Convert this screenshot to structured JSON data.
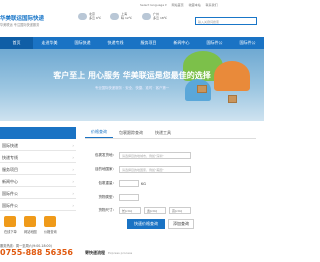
{
  "header": {
    "logo_title": "华美联运国际快递",
    "logo_sub": "华美联运 专注国际快递服务",
    "weather": [
      {
        "city": "北京",
        "temp": "多云 6℃"
      },
      {
        "city": "上海",
        "temp": "晴 12℃"
      },
      {
        "city": "广州",
        "temp": "多云 18℃"
      }
    ],
    "toplinks": [
      "Select language ▾",
      "网站首页",
      "收藏本站",
      "联系我们"
    ],
    "search_placeholder": "输入关键词搜索"
  },
  "nav": {
    "items": [
      "首页",
      "走进华美",
      "国际快递",
      "快递专线",
      "服务项目",
      "新闻中心",
      "国际件公",
      "国际件公"
    ],
    "active_index": 0
  },
  "banner": {
    "headline": "客户至上 用心服务 华美联运是您最佳的选择",
    "sub": "专业国际快递服务 · 安全、快捷、准时 · 客户第一"
  },
  "sidebar": {
    "rows": [
      "国际快递",
      "快递专线",
      "服务项目",
      "新闻中心",
      "国际件公",
      "国际件公"
    ],
    "services": [
      "在线下单",
      "网站地图",
      "价格查询"
    ],
    "hotline_label": "服务热线：周一至周六(9:00-18:00)",
    "hotline": "0755-888 56356"
  },
  "query": {
    "tabs": [
      "价格查询",
      "包裹跟踪查询",
      "快递工具"
    ],
    "active_tab": 0,
    "fields": [
      {
        "label": "包裹发货地：",
        "placeholder": "请选择目的地城市，例如\"深圳\""
      },
      {
        "label": "目的地国家：",
        "placeholder": "请选择目的地国家，例如\"美国\""
      },
      {
        "label": "包裹重量：",
        "placeholder": "",
        "unit": "KG"
      },
      {
        "label": "货物类型：",
        "placeholder": ""
      },
      {
        "label": "货物尺寸：",
        "selects": [
          "长(cm)",
          "宽(cm)",
          "高(cm)"
        ]
      }
    ],
    "query_button": "快速价格查询",
    "add_button": "添加查询"
  },
  "process": {
    "title": "寄快递流程",
    "en": "Express process"
  }
}
